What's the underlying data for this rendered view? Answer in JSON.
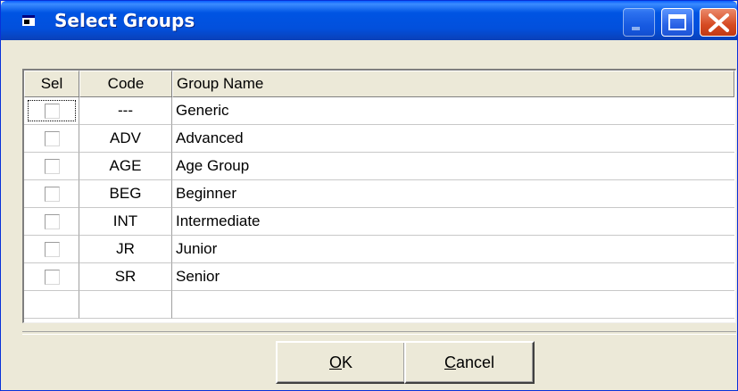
{
  "window": {
    "title": "Select Groups",
    "colors": {
      "titlebar": "#0054e3",
      "close_button": "#d64a22",
      "face": "#ece9d8"
    }
  },
  "titlebar_buttons": [
    "minimize-icon",
    "maximize-icon",
    "close-icon"
  ],
  "grid": {
    "headers": {
      "sel": "Sel",
      "code": "Code",
      "name": "Group Name"
    },
    "rows": [
      {
        "code": "---",
        "name": "Generic",
        "selected": false,
        "focused": true
      },
      {
        "code": "ADV",
        "name": "Advanced",
        "selected": false
      },
      {
        "code": "AGE",
        "name": "Age Group",
        "selected": false
      },
      {
        "code": "BEG",
        "name": "Beginner",
        "selected": false
      },
      {
        "code": "INT",
        "name": "Intermediate",
        "selected": false
      },
      {
        "code": "JR",
        "name": "Junior",
        "selected": false
      },
      {
        "code": "SR",
        "name": "Senior",
        "selected": false
      },
      {
        "code": "",
        "name": "",
        "selected": false,
        "empty": true
      }
    ]
  },
  "buttons": {
    "ok": {
      "mnemonic": "O",
      "rest": "K"
    },
    "cancel": {
      "mnemonic": "C",
      "rest": "ancel"
    }
  }
}
